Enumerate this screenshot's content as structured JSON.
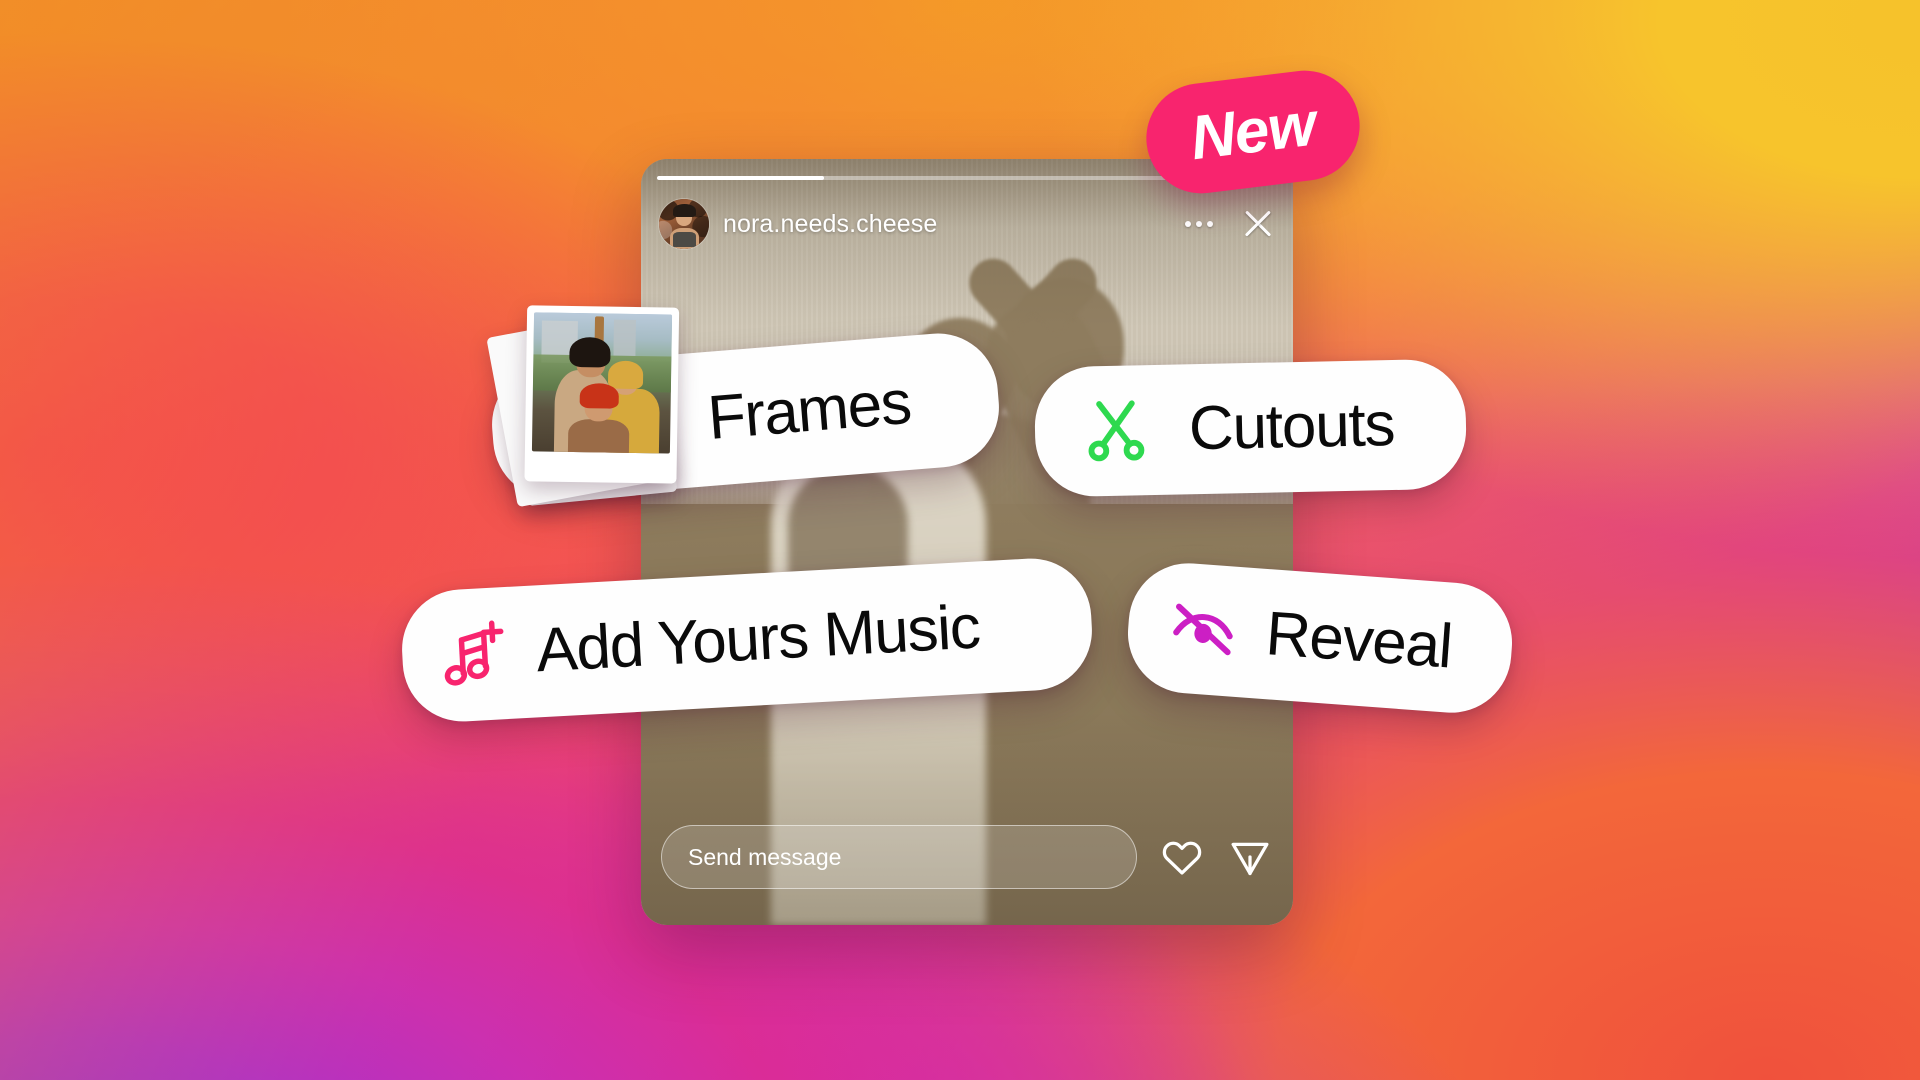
{
  "background": {
    "gradient_colors": [
      "#f5c22b",
      "#f18a28",
      "#f4405a",
      "#d32ab4",
      "#9c2ce8"
    ]
  },
  "badge": {
    "label": "New",
    "color": "#f8246e",
    "text_color": "#ffffff"
  },
  "story": {
    "username": "nora.needs.cheese",
    "avatar_name": "profile-avatar",
    "more_icon": "more-options-icon",
    "close_icon": "close-icon",
    "progress": {
      "segments": 1,
      "current_fill_percent": 27
    },
    "reply": {
      "placeholder": "Send message",
      "value": "",
      "like_icon": "heart-icon",
      "share_icon": "paper-plane-icon"
    }
  },
  "features": [
    {
      "id": "frames",
      "label": "Frames",
      "icon": "polaroid-photo-stack-icon",
      "icon_color": "#ffffff"
    },
    {
      "id": "cutouts",
      "label": "Cutouts",
      "icon": "scissors-icon",
      "icon_color": "#2ed94f"
    },
    {
      "id": "add-yours-music",
      "label": "Add Yours Music",
      "icon": "music-note-plus-icon",
      "icon_color": "#f8246e"
    },
    {
      "id": "reveal",
      "label": "Reveal",
      "icon": "eye-slash-icon",
      "icon_color": "#cc1fc4"
    }
  ]
}
